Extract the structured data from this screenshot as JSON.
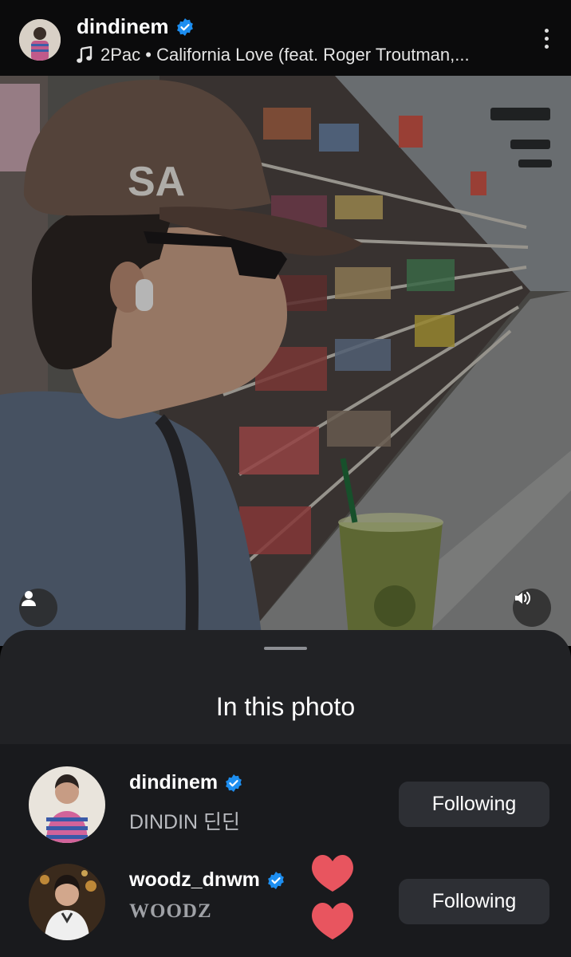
{
  "header": {
    "username": "dindinem",
    "verified": true,
    "music_icon": "music-note-icon",
    "song": "2Pac • California Love (feat. Roger Troutman,..."
  },
  "photo": {
    "description_icon_left": "person-icon",
    "description_icon_right": "speaker-icon"
  },
  "sheet": {
    "title": "In this photo",
    "people": [
      {
        "username": "dindinem",
        "display_name": "DINDIN 딘딘",
        "verified": true,
        "button_label": "Following"
      },
      {
        "username": "woodz_dnwm",
        "display_name": "WOODZ",
        "verified": true,
        "button_label": "Following"
      }
    ]
  },
  "colors": {
    "verified_blue": "#1d8ef0",
    "sheet_bg": "#212225",
    "list_bg": "#191a1d",
    "button_bg": "#2d2f34",
    "heart": "#e8555f"
  }
}
